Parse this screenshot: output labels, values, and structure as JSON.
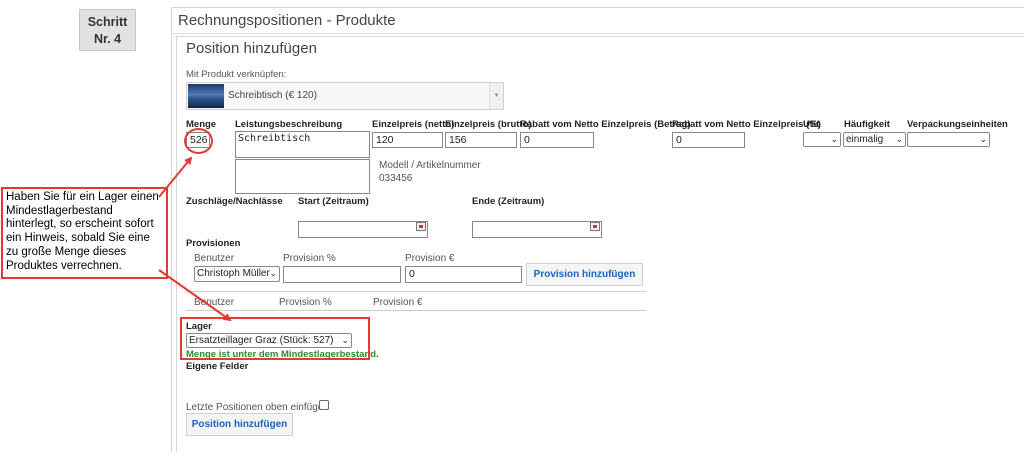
{
  "step": {
    "line1": "Schritt",
    "line2": "Nr. 4"
  },
  "section_title": "Rechnungspositionen - Produkte",
  "panel_title": "Position hinzufügen",
  "product": {
    "label": "Mit Produkt verknüpfen:",
    "selected": "Schreibtisch (€ 120)",
    "arrow": "▾"
  },
  "columns": {
    "menge": "Menge",
    "leistung": "Leistungsbeschreibung",
    "netto": "Einzelpreis (netto)",
    "brutto": "Einzelpreis (brutto)",
    "rabatt_betrag": "Rabatt vom Netto Einzelpreis (Betrag)",
    "rabatt_prozent": "Rabatt vom Netto Einzelpreis (%)",
    "ust": "USt",
    "haeufigkeit": "Häufigkeit",
    "verpackung": "Verpackungseinheiten"
  },
  "values": {
    "menge": "526",
    "leistung": "Schreibtisch",
    "netto": "120",
    "brutto": "156",
    "rabatt_betrag": "0",
    "rabatt_prozent": "0",
    "ust": "",
    "haeufigkeit": "einmalig",
    "verpackung": ""
  },
  "modell": {
    "label": "Modell / Artikelnummer",
    "value": "033456"
  },
  "zuschlaege_label": "Zuschläge/Nachlässe",
  "start_label": "Start (Zeitraum)",
  "ende_label": "Ende (Zeitraum)",
  "provisionen": {
    "title": "Provisionen",
    "benutzer_label": "Benutzer",
    "prozent_label": "Provision %",
    "euro_label": "Provision €",
    "benutzer_value": "Christoph Müller",
    "prozent_value": "",
    "euro_value": "0",
    "add_button": "Provision hinzufügen",
    "table_headers": [
      "Benutzer",
      "Provision %",
      "Provision €"
    ]
  },
  "lager": {
    "label": "Lager",
    "selected": "Ersatzteillager Graz (Stück: 527)",
    "warning": "Menge ist unter dem Mindestlagerbestand."
  },
  "eigene_felder": "Eigene Felder",
  "letzte_positionen": "Letzte Positionen oben einfügen",
  "add_position_button": "Position hinzufügen",
  "annotation": "Haben Sie für ein Lager einen Mindestlagerbestand hinterlegt, so erscheint sofort ein Hinweis, sobald Sie eine zu große Menge dieses Produktes verrechnen.",
  "colors": {
    "annotation": "#e53935",
    "link": "#1565c0",
    "warning": "#2e8b2e"
  }
}
